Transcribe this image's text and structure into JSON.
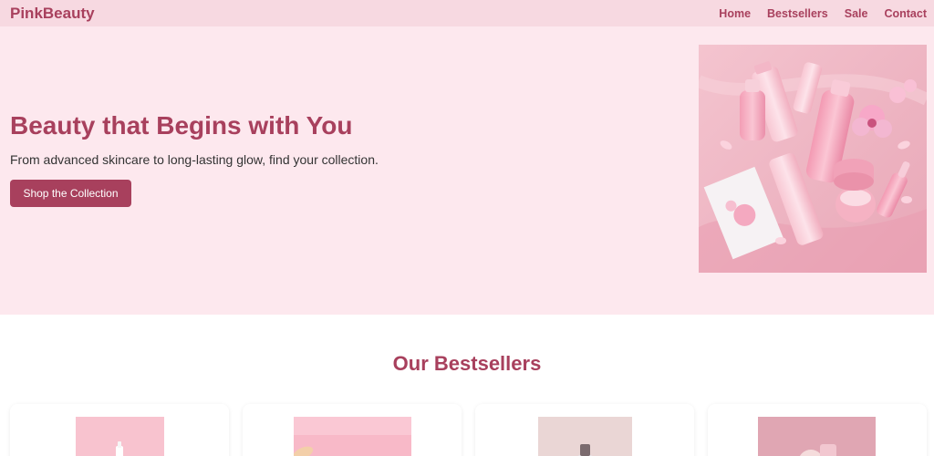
{
  "header": {
    "brand": "PinkBeauty",
    "nav": [
      {
        "label": "Home"
      },
      {
        "label": "Bestsellers"
      },
      {
        "label": "Sale"
      },
      {
        "label": "Contact"
      }
    ]
  },
  "hero": {
    "title": "Beauty that Begins with You",
    "subtitle": "From advanced skincare to long-lasting glow, find your collection.",
    "cta_label": "Shop the Collection",
    "image_icon": "skincare-products-image"
  },
  "bestsellers": {
    "title": "Our Bestsellers",
    "products": [
      {
        "image_icon": "product-1-image"
      },
      {
        "image_icon": "product-2-image"
      },
      {
        "image_icon": "product-3-image"
      },
      {
        "image_icon": "product-4-image"
      }
    ]
  },
  "colors": {
    "accent": "#a8405d",
    "header_bg": "#f7d9e1",
    "hero_bg": "#fde8ee"
  }
}
